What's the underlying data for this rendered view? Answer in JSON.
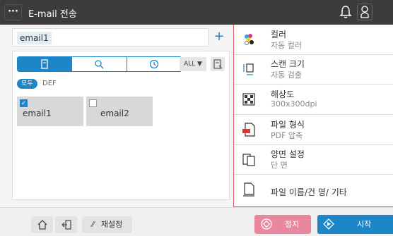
{
  "header": {
    "menu_label": "···",
    "title": "E-mail 전송"
  },
  "destination": {
    "chip": "email1",
    "add_label": "+"
  },
  "address_book": {
    "sort_label": "ALL ▼",
    "filters": [
      "모두",
      "DEF"
    ],
    "entries": [
      {
        "label": "email1",
        "checked": true
      },
      {
        "label": "email2",
        "checked": false
      }
    ]
  },
  "settings": [
    {
      "title": "컬러",
      "value": "자동 컬러",
      "icon": "color-icon"
    },
    {
      "title": "스캔 크기",
      "value": "자동 검출",
      "icon": "scan-size-icon"
    },
    {
      "title": "해상도",
      "value": "300x300dpi",
      "icon": "resolution-icon"
    },
    {
      "title": "파일 형식",
      "value": "PDF 압축",
      "icon": "file-format-icon"
    },
    {
      "title": "양면 설정",
      "value": "단 면",
      "icon": "duplex-icon"
    },
    {
      "title": "파일 이름/건 명/ 기타",
      "value": "",
      "icon": "file-name-icon"
    }
  ],
  "bottom": {
    "reset_label": "재설정",
    "stop_label": "정지",
    "start_label": "시작"
  },
  "colors": {
    "accent": "#1d86c8",
    "stop": "#e8879d",
    "highlight_border": "#e06060",
    "topbar": "#3c3c3c"
  }
}
